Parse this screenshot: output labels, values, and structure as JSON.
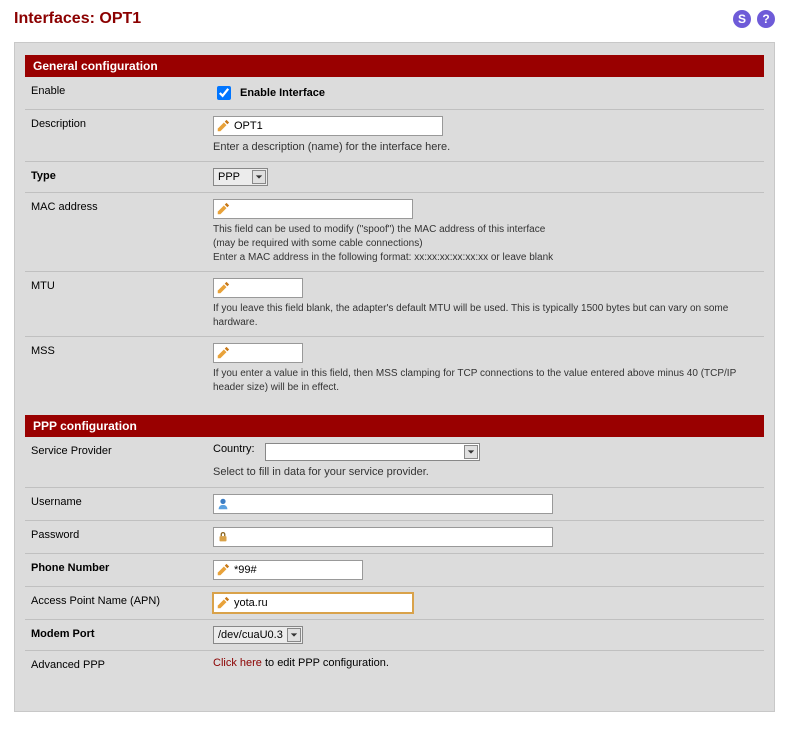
{
  "header": {
    "title": "Interfaces: OPT1"
  },
  "sections": {
    "general": {
      "title": "General configuration",
      "enable": {
        "label": "Enable",
        "checkbox_label": "Enable Interface",
        "checked": true
      },
      "description": {
        "label": "Description",
        "value": "OPT1",
        "hint": "Enter a description (name) for the interface here."
      },
      "type": {
        "label": "Type",
        "value": "PPP"
      },
      "mac": {
        "label": "MAC address",
        "value": "",
        "hint_line1": "This field can be used to modify (\"spoof\") the MAC address of this interface",
        "hint_line2": "(may be required with some cable connections)",
        "hint_line3": "Enter a MAC address in the following format: xx:xx:xx:xx:xx:xx or leave blank"
      },
      "mtu": {
        "label": "MTU",
        "value": "",
        "hint": "If you leave this field blank, the adapter's default MTU will be used. This is typically 1500 bytes but can vary on some hardware."
      },
      "mss": {
        "label": "MSS",
        "value": "",
        "hint": "If you enter a value in this field, then MSS clamping for TCP connections to the value entered above minus 40 (TCP/IP header size) will be in effect."
      }
    },
    "ppp": {
      "title": "PPP configuration",
      "service_provider": {
        "label": "Service Provider",
        "country_label": "Country:",
        "country_value": "",
        "hint": "Select to fill in data for your service provider."
      },
      "username": {
        "label": "Username",
        "value": ""
      },
      "password": {
        "label": "Password",
        "value": ""
      },
      "phone": {
        "label": "Phone Number",
        "value": "*99#"
      },
      "apn": {
        "label": "Access Point Name (APN)",
        "value": "yota.ru"
      },
      "modem_port": {
        "label": "Modem Port",
        "value": "/dev/cuaU0.3"
      },
      "advanced": {
        "label": "Advanced PPP",
        "link_text": "Click here",
        "suffix": " to edit PPP configuration."
      }
    }
  }
}
